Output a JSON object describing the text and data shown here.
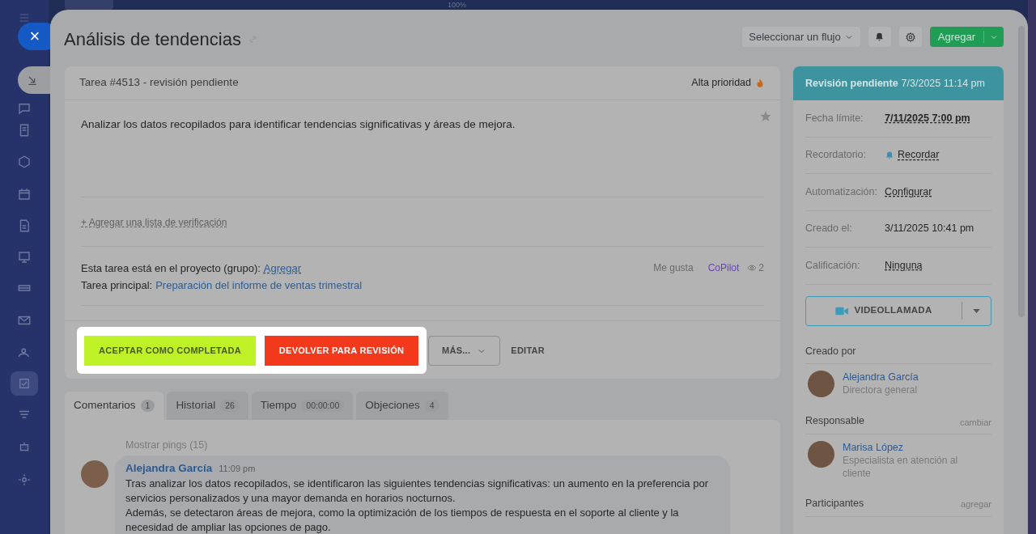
{
  "zoom_label": "100%",
  "sidebar": {
    "items": [
      {
        "selected": false
      },
      {
        "selected": false
      },
      {
        "selected": false
      },
      {
        "selected": false
      },
      {
        "selected": false
      },
      {
        "selected": false
      },
      {
        "selected": false
      },
      {
        "selected": false
      },
      {
        "selected": false
      },
      {
        "selected": true
      },
      {
        "selected": false
      },
      {
        "selected": false
      },
      {
        "selected": false
      }
    ]
  },
  "close_button": "×",
  "title": "Análisis de tendencias",
  "toolbar": {
    "flow_select": "Seleccionar un flujo",
    "add_button": "Agregar"
  },
  "task": {
    "header": "Tarea #4513 - revisión pendiente",
    "priority": "Alta prioridad",
    "starred": false,
    "description": "Analizar los datos recopilados para identificar tendencias significativas y áreas de mejora.",
    "checklist_link": "+ Agregar una lista de verificación",
    "project_label": "Esta tarea está en el proyecto (grupo):",
    "project_link": "Agregar",
    "parent_label": "Tarea principal:",
    "parent_link": "Preparación del informe de ventas trimestral",
    "like": "Me gusta",
    "copilot": "CoPilot",
    "views": "2"
  },
  "actions": [
    {
      "label": "ACEPTAR COMO COMPLETADA",
      "kind": "accept"
    },
    {
      "label": "DEVOLVER PARA REVISIÓN",
      "kind": "return"
    },
    {
      "label": "MÁS...",
      "kind": "more"
    },
    {
      "label": "EDITAR",
      "kind": "plain"
    }
  ],
  "tabs": [
    {
      "label": "Comentarios",
      "count": "1",
      "selected": true
    },
    {
      "label": "Historial",
      "count": "26",
      "selected": false
    },
    {
      "label": "Tiempo",
      "count": "00:00:00",
      "selected": false
    },
    {
      "label": "Objeciones",
      "count": "4",
      "selected": false
    }
  ],
  "comments": {
    "show_pings": "Mostrar pings (15)",
    "items": [
      {
        "author": "Alejandra García",
        "time": "11:09 pm",
        "paragraphs": [
          "Tras analizar los datos recopilados, se identificaron las siguientes tendencias significativas: un aumento en la preferencia por servicios personalizados y una mayor demanda en horarios nocturnos.",
          "Además, se detectaron áreas de mejora, como la optimización de los tiempos de respuesta en el soporte al cliente y la necesidad de ampliar las opciones de pago."
        ]
      }
    ]
  },
  "status": {
    "label": "Revisión pendiente",
    "date": "7/3/2025 11:14 pm"
  },
  "fields": [
    {
      "label": "Fecha límite:",
      "value": "7/11/2025 7:00 pm",
      "kind": "deadline"
    },
    {
      "label": "Recordatorio:",
      "value": "Recordar",
      "kind": "reminder"
    },
    {
      "label": "Automatización:",
      "value": "Configurar",
      "kind": "link"
    },
    {
      "label": "Creado el:",
      "value": "3/11/2025 10:41 pm",
      "kind": "text"
    },
    {
      "label": "Calificación:",
      "value": "Ninguna",
      "kind": "link"
    }
  ],
  "video_call": "VIDEOLLAMADA",
  "people": [
    {
      "heading": "Creado por",
      "name": "Alejandra García",
      "role": "Directora general"
    },
    {
      "heading": "Responsable",
      "action": "cambiar",
      "name": "Marisa López",
      "role": "Especialista en atención al cliente"
    },
    {
      "heading": "Participantes",
      "action": "agregar"
    }
  ]
}
